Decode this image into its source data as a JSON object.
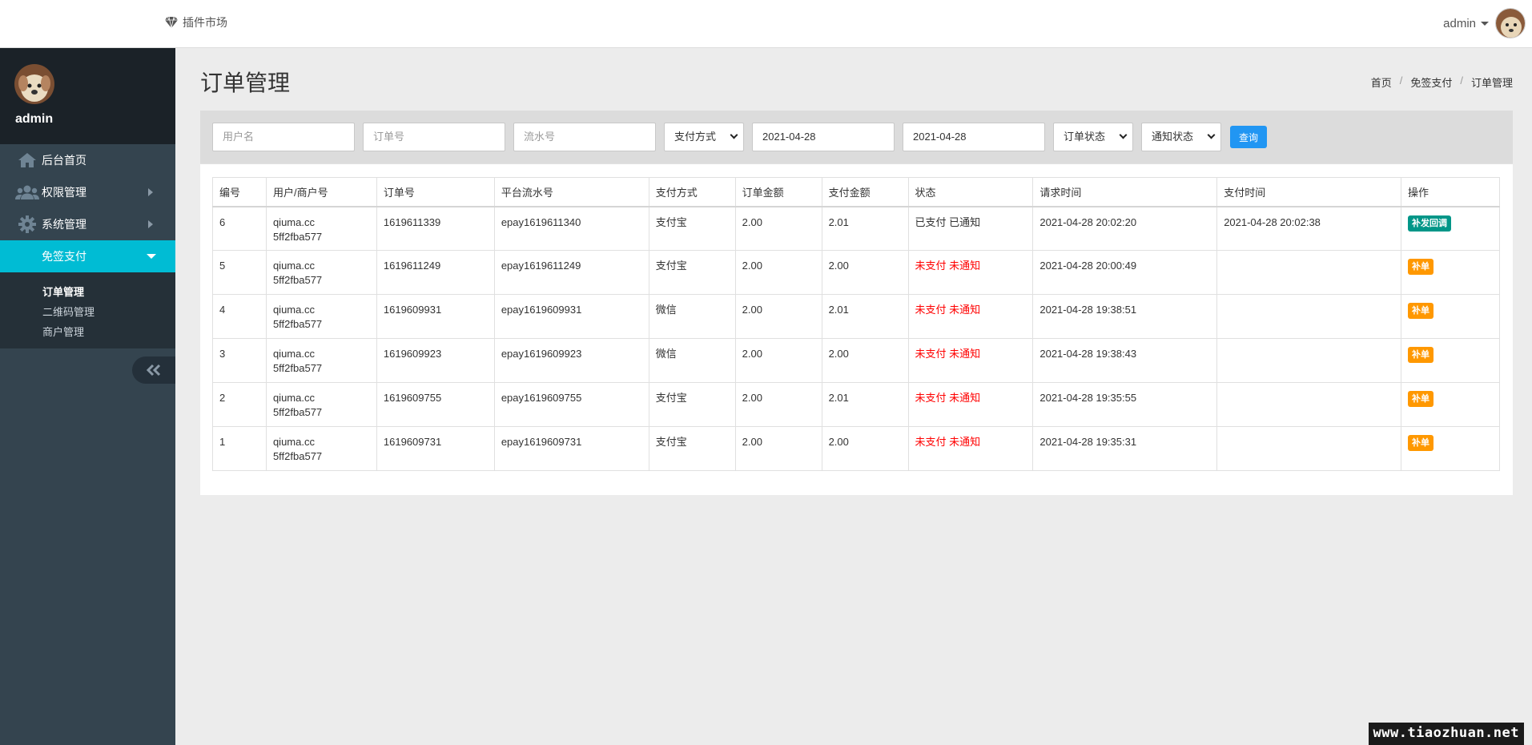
{
  "header": {
    "plugin_market": "插件市场",
    "user_name": "admin"
  },
  "sidebar": {
    "profile_name": "admin",
    "items": [
      {
        "label": "后台首页",
        "icon": "home-icon"
      },
      {
        "label": "权限管理",
        "icon": "users-icon"
      },
      {
        "label": "系统管理",
        "icon": "gear-icon"
      },
      {
        "label": "免签支付",
        "icon": "none"
      }
    ],
    "subitems": [
      "订单管理",
      "二维码管理",
      "商户管理"
    ],
    "active_subitem": "订单管理"
  },
  "page": {
    "title": "订单管理",
    "breadcrumb": [
      "首页",
      "免签支付",
      "订单管理"
    ]
  },
  "filters": {
    "username_placeholder": "用户名",
    "order_no_placeholder": "订单号",
    "serial_no_placeholder": "流水号",
    "pay_method": "支付方式",
    "date_from": "2021-04-28",
    "date_to": "2021-04-28",
    "order_status": "订单状态",
    "notify_status": "通知状态",
    "search_label": "查询"
  },
  "table": {
    "headers": [
      "编号",
      "用户/商户号",
      "订单号",
      "平台流水号",
      "支付方式",
      "订单金额",
      "支付金额",
      "状态",
      "请求时间",
      "支付时间",
      "操作"
    ],
    "rows": [
      {
        "id": "6",
        "user": "qiuma.cc",
        "merchant": "5ff2fba577",
        "order": "1619611339",
        "serial": "epay1619611340",
        "method": "支付宝",
        "amount": "2.00",
        "paid": "2.01",
        "status": "已支付 已通知",
        "status_color": "#333333",
        "request_time": "2021-04-28 20:02:20",
        "pay_time": "2021-04-28 20:02:38",
        "action": "补发回调",
        "action_color": "#009688"
      },
      {
        "id": "5",
        "user": "qiuma.cc",
        "merchant": "5ff2fba577",
        "order": "1619611249",
        "serial": "epay1619611249",
        "method": "支付宝",
        "amount": "2.00",
        "paid": "2.00",
        "status": "未支付 未通知",
        "status_color": "#ff0000",
        "request_time": "2021-04-28 20:00:49",
        "pay_time": "",
        "action": "补单",
        "action_color": "#ff9800"
      },
      {
        "id": "4",
        "user": "qiuma.cc",
        "merchant": "5ff2fba577",
        "order": "1619609931",
        "serial": "epay1619609931",
        "method": "微信",
        "amount": "2.00",
        "paid": "2.01",
        "status": "未支付 未通知",
        "status_color": "#ff0000",
        "request_time": "2021-04-28 19:38:51",
        "pay_time": "",
        "action": "补单",
        "action_color": "#ff9800"
      },
      {
        "id": "3",
        "user": "qiuma.cc",
        "merchant": "5ff2fba577",
        "order": "1619609923",
        "serial": "epay1619609923",
        "method": "微信",
        "amount": "2.00",
        "paid": "2.00",
        "status": "未支付 未通知",
        "status_color": "#ff0000",
        "request_time": "2021-04-28 19:38:43",
        "pay_time": "",
        "action": "补单",
        "action_color": "#ff9800"
      },
      {
        "id": "2",
        "user": "qiuma.cc",
        "merchant": "5ff2fba577",
        "order": "1619609755",
        "serial": "epay1619609755",
        "method": "支付宝",
        "amount": "2.00",
        "paid": "2.01",
        "status": "未支付 未通知",
        "status_color": "#ff0000",
        "request_time": "2021-04-28 19:35:55",
        "pay_time": "",
        "action": "补单",
        "action_color": "#ff9800"
      },
      {
        "id": "1",
        "user": "qiuma.cc",
        "merchant": "5ff2fba577",
        "order": "1619609731",
        "serial": "epay1619609731",
        "method": "支付宝",
        "amount": "2.00",
        "paid": "2.00",
        "status": "未支付 未通知",
        "status_color": "#ff0000",
        "request_time": "2021-04-28 19:35:31",
        "pay_time": "",
        "action": "补单",
        "action_color": "#ff9800"
      }
    ]
  },
  "watermark": "www.tiaozhuan.net"
}
